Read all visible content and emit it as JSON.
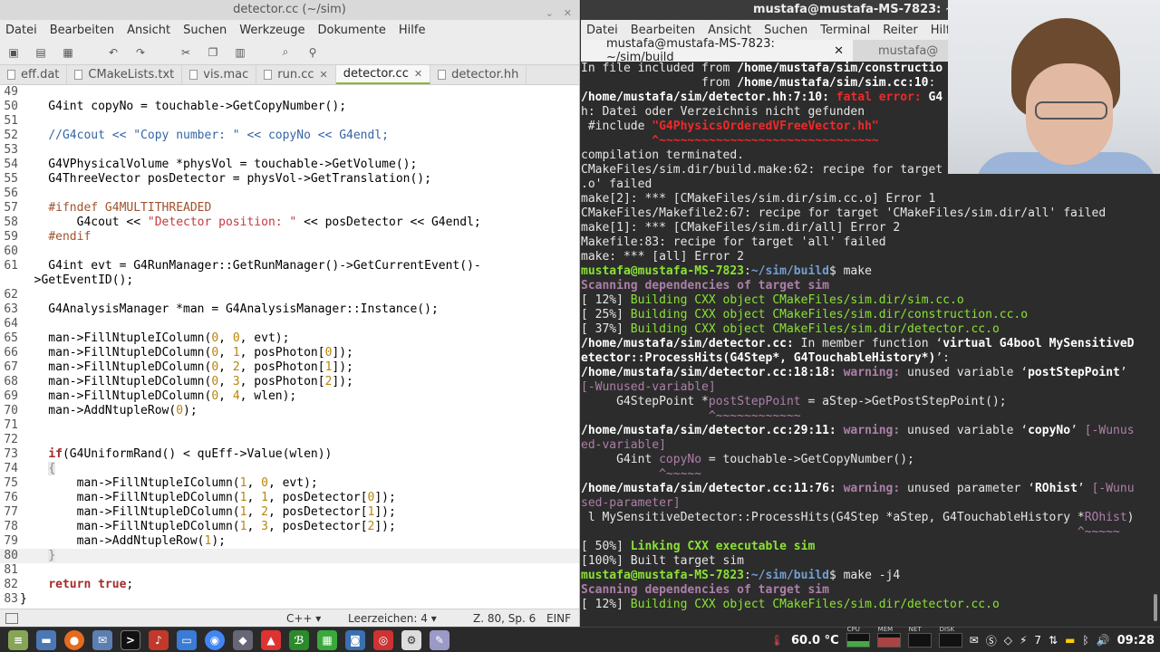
{
  "editor": {
    "title": "detector.cc (~/sim)",
    "menu": [
      "Datei",
      "Bearbeiten",
      "Ansicht",
      "Suchen",
      "Werkzeuge",
      "Dokumente",
      "Hilfe"
    ],
    "tabs": [
      {
        "label": "eff.dat",
        "active": false
      },
      {
        "label": "CMakeLists.txt",
        "active": false
      },
      {
        "label": "vis.mac",
        "active": false
      },
      {
        "label": "run.cc",
        "active": false
      },
      {
        "label": "detector.cc",
        "active": true
      },
      {
        "label": "detector.hh",
        "active": false
      }
    ],
    "status": {
      "language": "C++ ▾",
      "indent": "Leerzeichen: 4 ▾",
      "position": "Z. 80, Sp. 6",
      "mode": "EINF"
    }
  },
  "code_lines": [
    {
      "n": "49",
      "html": ""
    },
    {
      "n": "50",
      "html": "    G4int copyNo = touchable->GetCopyNumber();"
    },
    {
      "n": "51",
      "html": ""
    },
    {
      "n": "52",
      "html": "    <span class='cm'>//G4cout &lt;&lt; \"Copy number: \" &lt;&lt; copyNo &lt;&lt; G4endl;</span>"
    },
    {
      "n": "53",
      "html": ""
    },
    {
      "n": "54",
      "html": "    G4VPhysicalVolume *physVol = touchable->GetVolume();"
    },
    {
      "n": "55",
      "html": "    G4ThreeVector posDetector = physVol->GetTranslation();"
    },
    {
      "n": "56",
      "html": ""
    },
    {
      "n": "57",
      "html": "    <span class='pp'>#ifndef G4MULTITHREADED</span>"
    },
    {
      "n": "58",
      "html": "        G4cout &lt;&lt; <span class='str'>\"Detector position: \"</span> &lt;&lt; posDetector &lt;&lt; G4endl;"
    },
    {
      "n": "59",
      "html": "    <span class='pp'>#endif</span>"
    },
    {
      "n": "60",
      "html": ""
    },
    {
      "n": "61",
      "html": "    G4int evt = G4RunManager::GetRunManager()->GetCurrentEvent()-"
    },
    {
      "n": "",
      "html": "  >GetEventID();"
    },
    {
      "n": "62",
      "html": ""
    },
    {
      "n": "63",
      "html": "    G4AnalysisManager *man = G4AnalysisManager::Instance();"
    },
    {
      "n": "64",
      "html": ""
    },
    {
      "n": "65",
      "html": "    man->FillNtupleIColumn(<span class='num'>0</span>, <span class='num'>0</span>, evt);"
    },
    {
      "n": "66",
      "html": "    man->FillNtupleDColumn(<span class='num'>0</span>, <span class='num'>1</span>, posPhoton[<span class='num'>0</span>]);"
    },
    {
      "n": "67",
      "html": "    man->FillNtupleDColumn(<span class='num'>0</span>, <span class='num'>2</span>, posPhoton[<span class='num'>1</span>]);"
    },
    {
      "n": "68",
      "html": "    man->FillNtupleDColumn(<span class='num'>0</span>, <span class='num'>3</span>, posPhoton[<span class='num'>2</span>]);"
    },
    {
      "n": "69",
      "html": "    man->FillNtupleDColumn(<span class='num'>0</span>, <span class='num'>4</span>, wlen);"
    },
    {
      "n": "70",
      "html": "    man->AddNtupleRow(<span class='num'>0</span>);"
    },
    {
      "n": "71",
      "html": ""
    },
    {
      "n": "72",
      "html": ""
    },
    {
      "n": "73",
      "html": "    <span class='kw'>if</span>(G4UniformRand() &lt; quEff->Value(wlen))"
    },
    {
      "n": "74",
      "html": "    <span class='br'>{</span>"
    },
    {
      "n": "75",
      "html": "        man->FillNtupleIColumn(<span class='num'>1</span>, <span class='num'>0</span>, evt);"
    },
    {
      "n": "76",
      "html": "        man->FillNtupleDColumn(<span class='num'>1</span>, <span class='num'>1</span>, posDetector[<span class='num'>0</span>]);"
    },
    {
      "n": "77",
      "html": "        man->FillNtupleDColumn(<span class='num'>1</span>, <span class='num'>2</span>, posDetector[<span class='num'>1</span>]);"
    },
    {
      "n": "78",
      "html": "        man->FillNtupleDColumn(<span class='num'>1</span>, <span class='num'>3</span>, posDetector[<span class='num'>2</span>]);"
    },
    {
      "n": "79",
      "html": "        man->AddNtupleRow(<span class='num'>1</span>);"
    },
    {
      "n": "80",
      "html": "    <span class='br'>}</span>",
      "current": true
    },
    {
      "n": "81",
      "html": ""
    },
    {
      "n": "82",
      "html": "    <span class='kw'>return</span> <span class='kw'>true</span>;"
    },
    {
      "n": "83",
      "html": "}"
    }
  ],
  "terminal": {
    "title": "mustafa@mustafa-MS-7823: ~/sim,",
    "menu": [
      "Datei",
      "Bearbeiten",
      "Ansicht",
      "Suchen",
      "Terminal",
      "Reiter",
      "Hilfe"
    ],
    "tabs": [
      {
        "label": "mustafa@mustafa-MS-7823: ~/sim/build",
        "active": true
      },
      {
        "label": "mustafa@",
        "active": false
      }
    ],
    "lines": [
      "In file included from <span class='b'>/home/mustafa/sim/constructio</span>",
      "                 from <span class='b'>/home/mustafa/sim/sim.cc:10</span>:",
      "<span class='b'>/home/mustafa/sim/detector.hh:7:10:</span> <span class='r'>fatal error:</span> <span class='b'>G4</span>",
      "h: Datei oder Verzeichnis nicht gefunden",
      " #include <span class='r'>\"G4PhysicsOrderedVFreeVector.hh\"</span>",
      "          <span class='r'>^~~~~~~~~~~~~~~~~~~~~~~~~~~~~~~~</span>",
      "compilation terminated.",
      "CMakeFiles/sim.dir/build.make:62: recipe for target",
      ".o' failed",
      "make[2]: *** [CMakeFiles/sim.dir/sim.cc.o] Error 1",
      "CMakeFiles/Makefile2:67: recipe for target 'CMakeFiles/sim.dir/all' failed",
      "make[1]: *** [CMakeFiles/sim.dir/all] Error 2",
      "Makefile:83: recipe for target 'all' failed",
      "make: *** [all] Error 2",
      "<span class='gb'>mustafa@mustafa-MS-7823</span>:<span class='bl'>~/sim/build</span>$ make",
      "<span class='mb'>Scanning dependencies of target sim</span>",
      "[ 12%] <span class='g'>Building CXX object CMakeFiles/sim.dir/sim.cc.o</span>",
      "[ 25%] <span class='g'>Building CXX object CMakeFiles/sim.dir/construction.cc.o</span>",
      "[ 37%] <span class='g'>Building CXX object CMakeFiles/sim.dir/detector.cc.o</span>",
      "<span class='b'>/home/mustafa/sim/detector.cc:</span> In member function ‘<span class='b'>virtual G4bool MySensitiveD</span>",
      "<span class='b'>etector::ProcessHits(G4Step*, G4TouchableHistory*)</span>’:",
      "<span class='b'>/home/mustafa/sim/detector.cc:18:18:</span> <span class='mb'>warning:</span> unused variable ‘<span class='b'>postStepPoint</span>’",
      "<span class='m'>[-Wunused-variable]</span>",
      "     G4StepPoint *<span class='m'>postStepPoint</span> = aStep->GetPostStepPoint();",
      "                  <span class='m'>^~~~~~~~~~~~~</span>",
      "<span class='b'>/home/mustafa/sim/detector.cc:29:11:</span> <span class='mb'>warning:</span> unused variable ‘<span class='b'>copyNo</span>’ <span class='m'>[-Wunus</span>",
      "<span class='m'>ed-variable]</span>",
      "     G4int <span class='m'>copyNo</span> = touchable->GetCopyNumber();",
      "           <span class='m'>^~~~~~</span>",
      "<span class='b'>/home/mustafa/sim/detector.cc:11:76:</span> <span class='mb'>warning:</span> unused parameter ‘<span class='b'>ROhist</span>’ <span class='m'>[-Wunu</span>",
      "<span class='m'>sed-parameter]</span>",
      " l MySensitiveDetector::ProcessHits(G4Step *aStep, G4TouchableHistory *<span class='m'>ROhist</span>)",
      "                                                                      <span class='m'>^~~~~~</span>",
      "[ 50%] <span class='gb'>Linking CXX executable sim</span>",
      "[100%] Built target sim",
      "<span class='gb'>mustafa@mustafa-MS-7823</span>:<span class='bl'>~/sim/build</span>$ make -j4",
      "<span class='mb'>Scanning dependencies of target sim</span>",
      "[ 12%] <span class='g'>Building CXX object CMakeFiles/sim.dir/detector.cc.o</span>"
    ]
  },
  "panel": {
    "temperature": "60.0 °C",
    "graph_labels": [
      "CPU",
      "MEM",
      "NET",
      "DISK"
    ],
    "notification_count": "7",
    "clock": "09:28"
  }
}
